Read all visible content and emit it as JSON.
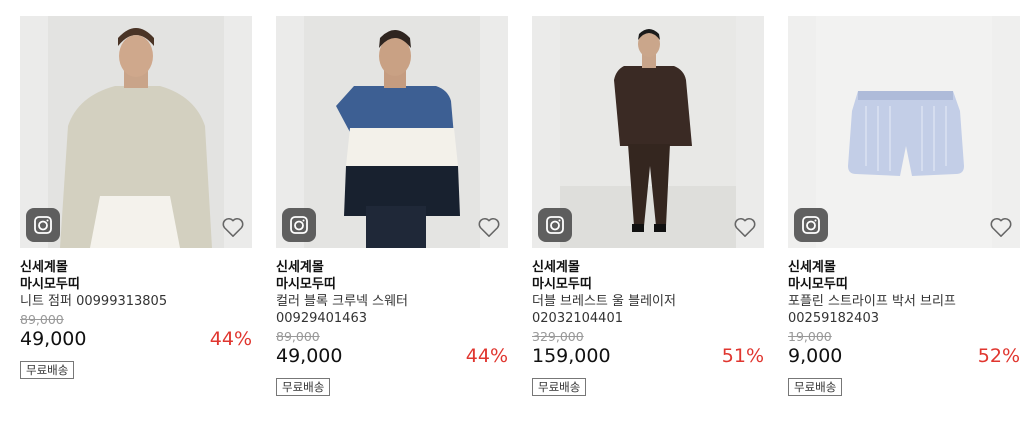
{
  "products": [
    {
      "brand": "신세계몰",
      "store": "마시모두띠",
      "name": "니트 점퍼 00999313805",
      "code": "",
      "original_price": "89,000",
      "price": "49,000",
      "discount": "44%",
      "shipping": "무료배송"
    },
    {
      "brand": "신세계몰",
      "store": "마시모두띠",
      "name": "컬러 블록 크루넥 스웨터",
      "code": "00929401463",
      "original_price": "89,000",
      "price": "49,000",
      "discount": "44%",
      "shipping": "무료배송"
    },
    {
      "brand": "신세계몰",
      "store": "마시모두띠",
      "name": "더블 브레스트 울 블레이저",
      "code": "02032104401",
      "original_price": "329,000",
      "price": "159,000",
      "discount": "51%",
      "shipping": "무료배송"
    },
    {
      "brand": "신세계몰",
      "store": "마시모두띠",
      "name": "포플린 스트라이프 박서 브리프",
      "code": "00259182403",
      "original_price": "19,000",
      "price": "9,000",
      "discount": "52%",
      "shipping": "무료배송"
    }
  ],
  "colors": {
    "discount": "#e0362f",
    "image_bg": "#f1f1f1"
  },
  "icons": {
    "image_search": "camera-icon",
    "wishlist": "heart-icon"
  }
}
